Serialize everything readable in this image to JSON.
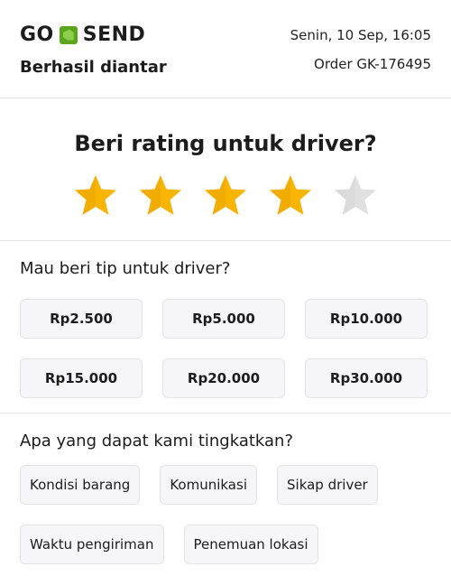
{
  "header": {
    "brand_go": "GO",
    "brand_send": "SEND",
    "status": "Berhasil diantar",
    "datetime": "Senin, 10 Sep, 16:05",
    "order_id": "Order GK-176495"
  },
  "rating": {
    "title": "Beri rating untuk driver?",
    "value": 4,
    "max": 5,
    "filled_color": "#f7b500",
    "empty_color": "#e0e0e0"
  },
  "tip": {
    "title": "Mau beri tip untuk driver?",
    "options": [
      "Rp2.500",
      "Rp5.000",
      "Rp10.000",
      "Rp15.000",
      "Rp20.000",
      "Rp30.000"
    ]
  },
  "improve": {
    "title": "Apa yang dapat kami tingkatkan?",
    "options": [
      "Kondisi barang",
      "Komunikasi",
      "Sikap driver",
      "Waktu pengiriman",
      "Penemuan lokasi"
    ]
  },
  "colors": {
    "brand_green": "#5aa51e"
  }
}
